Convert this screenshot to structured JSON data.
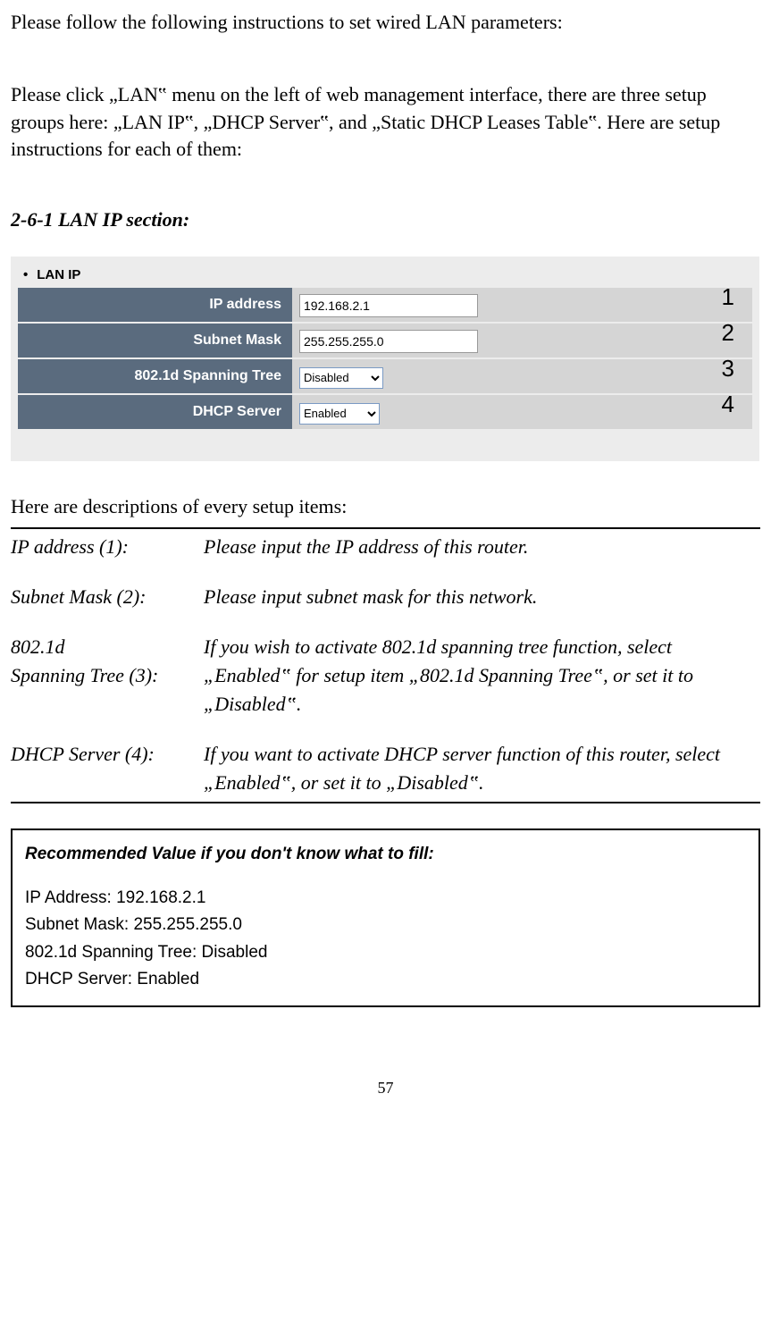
{
  "intro": {
    "p1": "Please follow the following instructions to set wired LAN parameters:",
    "p2": "Please click „LAN‟ menu on the left of web management interface, there are three setup groups here: „LAN IP‟, „DHCP Server‟, and „Static DHCP Leases Table‟. Here are setup instructions for each of them:"
  },
  "section_heading": "2-6-1 LAN IP section:",
  "lan_header": "LAN IP",
  "rows": [
    {
      "label": "IP address",
      "value": "192.168.2.1",
      "type": "text",
      "num": "1"
    },
    {
      "label": "Subnet Mask",
      "value": "255.255.255.0",
      "type": "text",
      "num": "2"
    },
    {
      "label": "802.1d Spanning Tree",
      "value": "Disabled",
      "type": "select",
      "num": "3"
    },
    {
      "label": "DHCP Server",
      "value": "Enabled",
      "type": "select",
      "num": "4"
    }
  ],
  "desc_intro": "Here are descriptions of every setup items:",
  "descriptions": [
    {
      "label": "IP address (1):",
      "value": "Please input the IP address of this router."
    },
    {
      "label": "Subnet Mask (2):",
      "value": "Please input subnet mask for this network."
    },
    {
      "label": "802.1d\nSpanning Tree (3):",
      "value": "If you wish to activate 802.1d spanning tree function, select „Enabled‟ for setup item „802.1d Spanning Tree‟, or set it to „Disabled‟."
    },
    {
      "label": "DHCP Server (4):",
      "value": "If you want to activate DHCP server function of this router, select „Enabled‟, or set it to „Disabled‟."
    }
  ],
  "rec": {
    "title": "Recommended Value if you don't know what to fill:",
    "lines": [
      "IP Address: 192.168.2.1",
      "Subnet Mask: 255.255.255.0",
      "802.1d Spanning Tree: Disabled",
      "DHCP Server: Enabled"
    ]
  },
  "page_number": "57"
}
